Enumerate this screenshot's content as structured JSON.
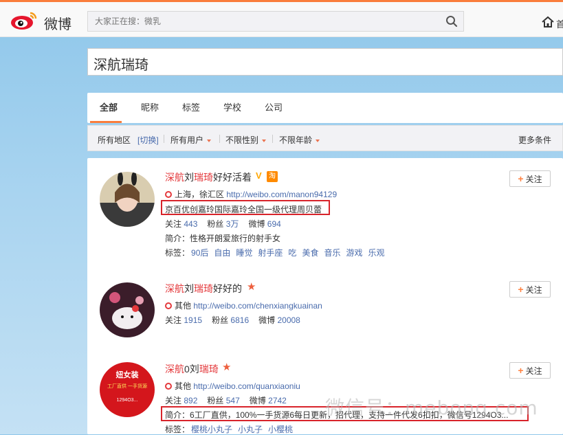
{
  "header": {
    "logo_text": "微博",
    "search_placeholder": "大家正在搜：微乳",
    "home_label": "首"
  },
  "query": "深航瑞琦",
  "tabs": [
    {
      "label": "全部",
      "active": true
    },
    {
      "label": "昵称",
      "active": false
    },
    {
      "label": "标签",
      "active": false
    },
    {
      "label": "学校",
      "active": false
    },
    {
      "label": "公司",
      "active": false
    }
  ],
  "filters": {
    "region_label": "所有地区",
    "switch_label": "[切换]",
    "user_type": "所有用户",
    "gender": "不限性别",
    "age": "不限年龄",
    "more": "更多条件"
  },
  "colors": {
    "accent": "#fa7d3c",
    "highlight": "#e4393c",
    "link": "#496bac",
    "box": "#d8232a"
  },
  "follow_label": "关注",
  "results": [
    {
      "name_parts": [
        "深航",
        "刘",
        "瑞琦",
        "好好活着"
      ],
      "badges": [
        "V",
        "淘"
      ],
      "location": "上海，徐汇区",
      "url": "http://weibo.com/manon94129",
      "verified_text": "京百优创嘉玲国际嘉玲全国一级代理周贝蕾",
      "stats_label_following": "关注",
      "following": "443",
      "stats_label_fans": "粉丝",
      "fans": "3万",
      "stats_label_posts": "微博",
      "posts": "694",
      "intro_label": "简介：",
      "intro": "性格开朗爱旅行的射手女",
      "tags_label": "标签：",
      "tags": [
        "90后",
        "自由",
        "睡觉",
        "射手座",
        "吃",
        "美食",
        "音乐",
        "游戏",
        "乐观"
      ]
    },
    {
      "name_parts": [
        "深航",
        "刘",
        "瑞琦",
        "好好的"
      ],
      "badges": [
        "star"
      ],
      "location": "其他",
      "url": "http://weibo.com/chenxiangkuainan",
      "stats_label_following": "关注",
      "following": "1915",
      "stats_label_fans": "粉丝",
      "fans": "6816",
      "stats_label_posts": "微博",
      "posts": "20008"
    },
    {
      "name_parts": [
        "深航",
        "0刘",
        "瑞琦",
        ""
      ],
      "badges": [
        "star"
      ],
      "location": "其他",
      "url": "http://weibo.com/quanxiaoniu",
      "stats_label_following": "关注",
      "following": "892",
      "stats_label_fans": "粉丝",
      "fans": "547",
      "stats_label_posts": "微博",
      "posts": "2742",
      "intro_label": "简介：",
      "intro": "6工厂直供，100%一手货源6每日更新，招代理，支持一件代发6扣扣，微信号1294O3...",
      "tags_label": "标签：",
      "tags": [
        "樱桃小丸子",
        "小丸子",
        "小樱桃"
      ],
      "avatar_text": [
        "妞女装",
        "工厂直供 一手货源",
        "1294O3..."
      ]
    }
  ],
  "watermark": "微信号：mebong.com"
}
